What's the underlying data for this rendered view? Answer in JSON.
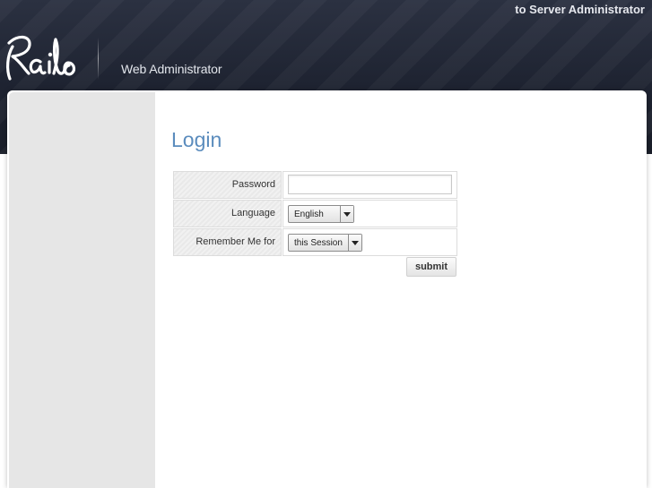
{
  "header": {
    "top_link": "to Server Administrator",
    "logo_text": "Railo",
    "app_title": "Web Administrator"
  },
  "login": {
    "title": "Login",
    "fields": {
      "password": {
        "label": "Password",
        "value": ""
      },
      "language": {
        "label": "Language",
        "selected": "English"
      },
      "remember": {
        "label": "Remember Me for",
        "selected": "this Session"
      }
    },
    "submit_label": "submit"
  },
  "icons": {
    "logo": "railo-logo-icon",
    "dropdown": "chevron-down-icon"
  },
  "colors": {
    "header_bg": "#1e2331",
    "title_blue": "#5b8cbd",
    "sidebar_bg": "#e6e6e6"
  }
}
